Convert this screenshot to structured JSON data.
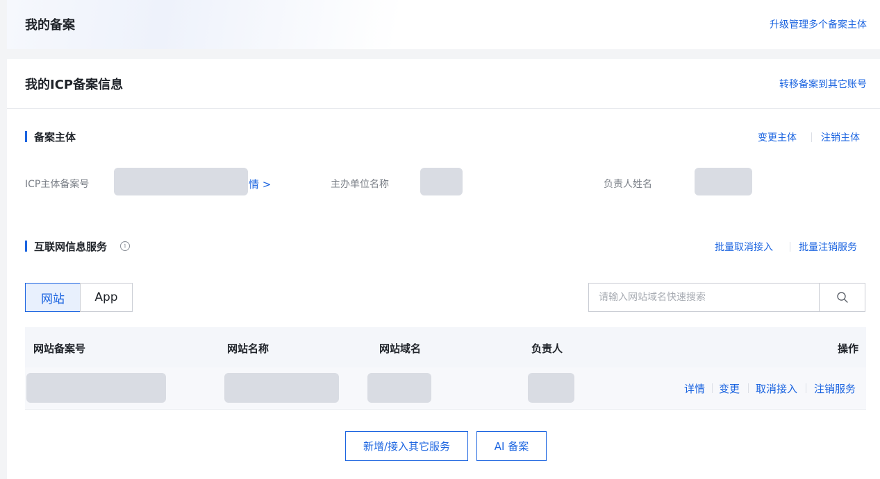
{
  "header": {
    "title": "我的备案",
    "upgrade_link": "升级管理多个备案主体"
  },
  "icp": {
    "title": "我的ICP备案信息",
    "transfer_link": "转移备案到其它账号"
  },
  "subject": {
    "section_title": "备案主体",
    "change_link": "变更主体",
    "cancel_link": "注销主体",
    "fields": {
      "icp_number_label": "ICP主体备案号",
      "detail_link": "情 >",
      "org_name_label": "主办单位名称",
      "owner_label": "负责人姓名"
    }
  },
  "services": {
    "section_title": "互联网信息服务",
    "info_icon": "i",
    "batch_unlink": "批量取消接入",
    "batch_cancel": "批量注销服务",
    "tabs": [
      {
        "label": "网站",
        "active": true
      },
      {
        "label": "App",
        "active": false
      }
    ],
    "search": {
      "placeholder": "请输入网站域名快速搜索",
      "value": ""
    }
  },
  "table": {
    "columns": [
      "网站备案号",
      "网站名称",
      "网站域名",
      "负责人",
      "操作"
    ],
    "row_actions": [
      "详情",
      "变更",
      "取消接入",
      "注销服务"
    ]
  },
  "footer": {
    "add_service_button": "新增/接入其它服务",
    "ai_button": "AI 备案"
  },
  "colors": {
    "accent": "#1b64e0",
    "mask": "#d9dce3"
  }
}
